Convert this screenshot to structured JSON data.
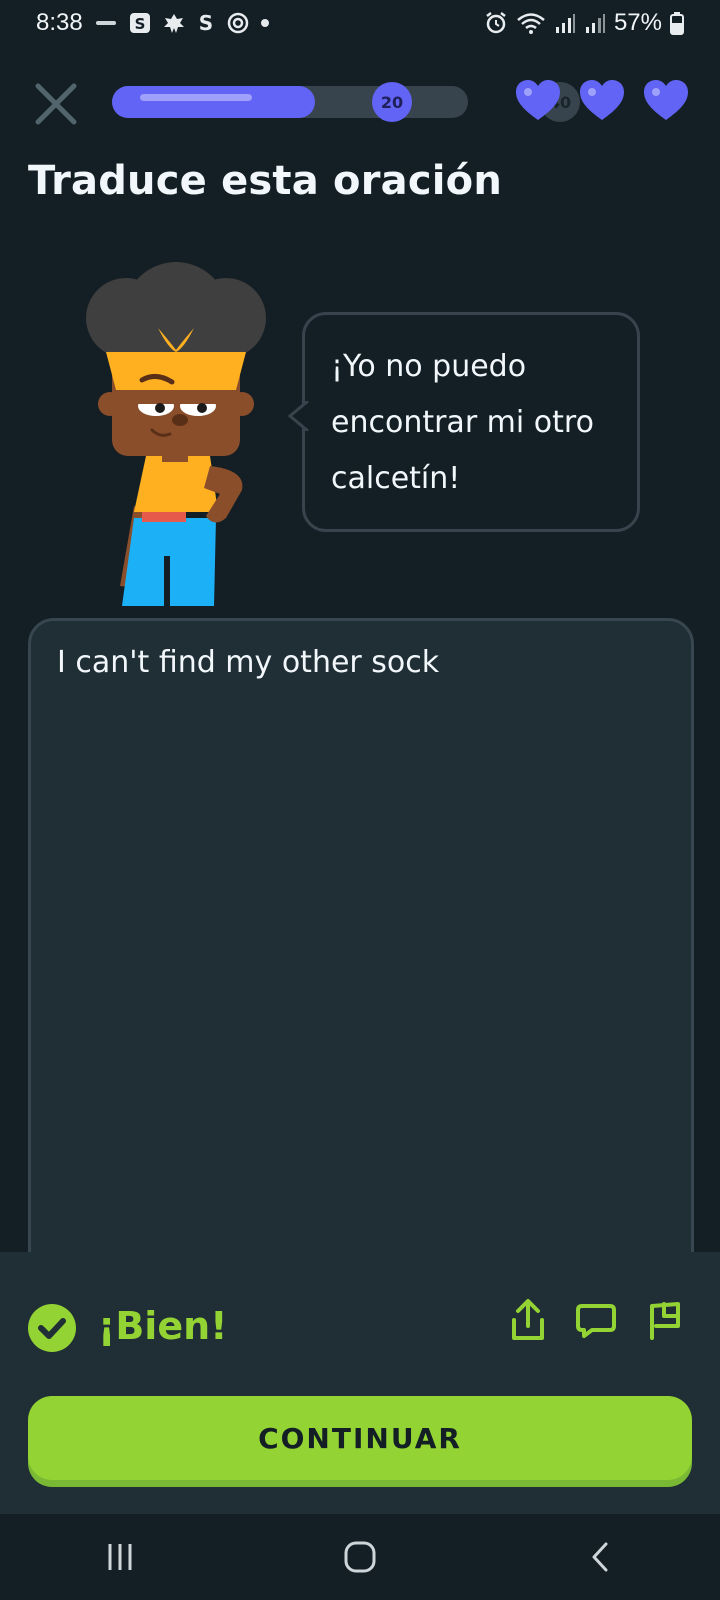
{
  "status_bar": {
    "time": "8:38",
    "battery_percent": "57%",
    "notification_icons": [
      "duolingo-mini-icon",
      "s-app-icon",
      "leaf-icon",
      "s-logo-icon",
      "target-icon",
      "dot-icon"
    ],
    "system_icons": [
      "alarm-icon",
      "wifi-icon",
      "signal-icon",
      "signal-icon",
      "battery-icon"
    ]
  },
  "header": {
    "close_icon": "close-icon",
    "progress": {
      "fill_fraction": 0.57,
      "milestone_reached": "20",
      "milestone_next": "40",
      "color": "#6164f5"
    },
    "hearts": {
      "count": 3,
      "color": "#6164f5"
    }
  },
  "prompt": {
    "title": "Traduce esta oración"
  },
  "speech_bubble": {
    "line1": "¡Yo no puedo",
    "line2": "encontrar mi otro",
    "line3": "calcetín!"
  },
  "answer": {
    "text": "I can't find my other sock"
  },
  "feedback": {
    "label": "¡Bien!",
    "status_color": "#93d333",
    "actions": [
      "share-icon",
      "comment-icon",
      "flag-icon"
    ]
  },
  "continue_button": {
    "label": "CONTINUAR",
    "color": "#93d333"
  },
  "nav_bar": {
    "buttons": [
      "recent-apps-icon",
      "home-icon",
      "back-icon"
    ]
  }
}
